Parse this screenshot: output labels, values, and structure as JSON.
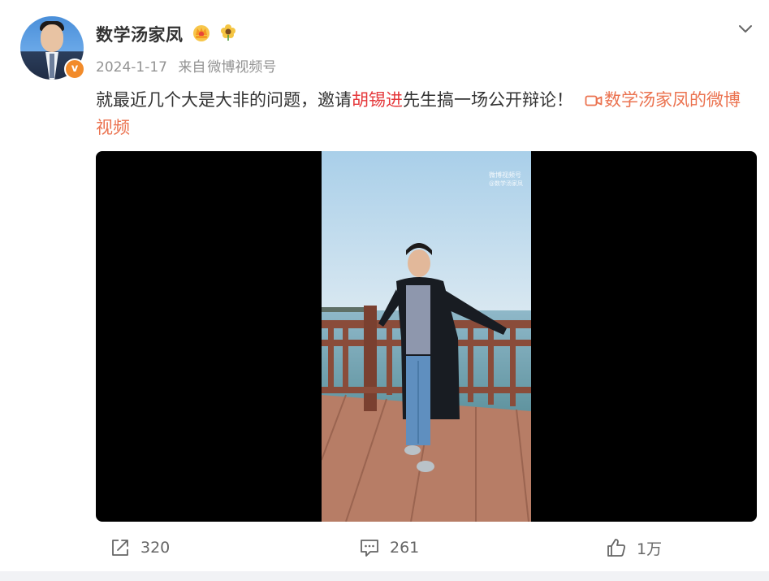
{
  "post": {
    "author": "数学汤家凤",
    "date": "2024-1-17",
    "source_prefix": "来自",
    "source": "微博视频号",
    "text_before": "就最近几个大是大非的问题，邀请",
    "mention": "胡锡进",
    "text_after": "先生搞一场公开辩论！",
    "video_link": "数学汤家凤的微博视频"
  },
  "video": {
    "watermark_line1": "微博视频号",
    "watermark_line2": "@数学汤家凤"
  },
  "actions": {
    "share_count": "320",
    "comment_count": "261",
    "like_count": "1万"
  },
  "icons": {
    "verified": "verified-badge-icon",
    "crown": "crown-badge-icon",
    "flower": "flower-badge-icon",
    "menu": "chevron-down-icon",
    "video_link": "video-camera-icon",
    "share": "share-icon",
    "comment": "comment-icon",
    "like": "thumbs-up-icon"
  },
  "colors": {
    "accent_link": "#eb7350",
    "mention": "#e5383b",
    "verified": "#f28b2a"
  }
}
